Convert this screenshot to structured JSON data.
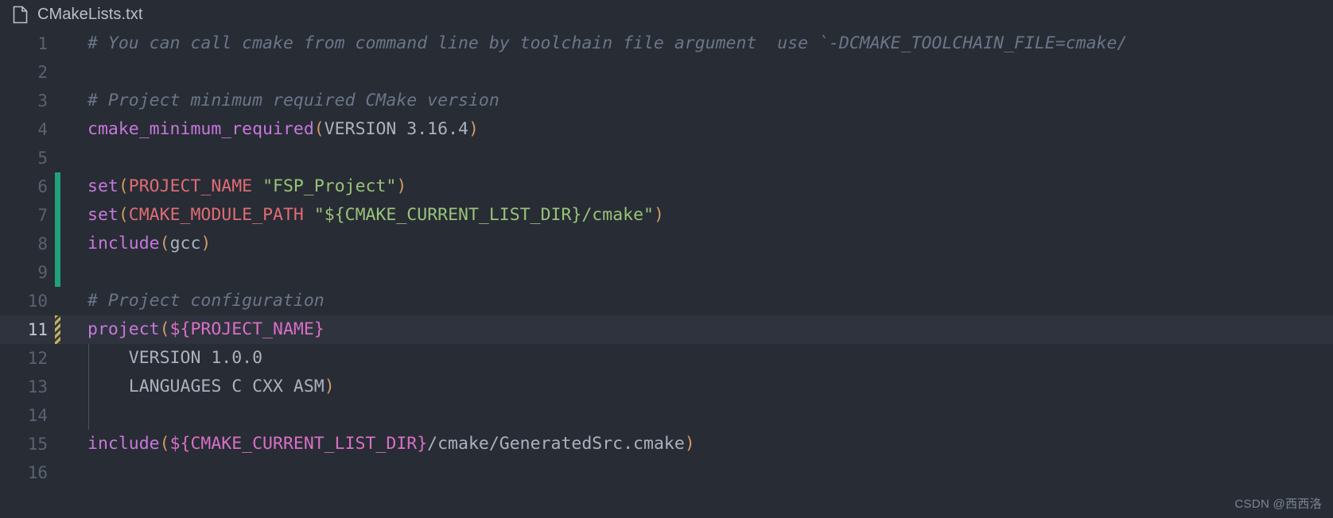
{
  "tab": {
    "filename": "CMakeLists.txt",
    "icon": "file-icon"
  },
  "watermark": "CSDN @西西洛",
  "colors": {
    "background": "#282c34",
    "active_line": "#2f333d",
    "gutter_text": "#5a6272",
    "gutter_active_text": "#c3cad6",
    "comment": "#6b7689",
    "function": "#c678dd",
    "paren": "#d19a66",
    "variable": "#e06c75",
    "string": "#98c379",
    "plain": "#abb2bf",
    "substitution": "#d96fc8",
    "git_added": "#21a179",
    "git_modified": "#b8a55a"
  },
  "editor": {
    "lines": [
      {
        "number": "1",
        "active": false,
        "marker": "none",
        "indent_guide": false,
        "tokens": [
          {
            "cls": "t-comment",
            "text": "# You can call cmake from command line by toolchain file argument  use `-DCMAKE_TOOLCHAIN_FILE=cmake/"
          }
        ]
      },
      {
        "number": "2",
        "active": false,
        "marker": "none",
        "indent_guide": false,
        "tokens": []
      },
      {
        "number": "3",
        "active": false,
        "marker": "none",
        "indent_guide": false,
        "tokens": [
          {
            "cls": "t-comment",
            "text": "# Project minimum required CMake version"
          }
        ]
      },
      {
        "number": "4",
        "active": false,
        "marker": "none",
        "indent_guide": false,
        "tokens": [
          {
            "cls": "t-func",
            "text": "cmake_minimum_required"
          },
          {
            "cls": "t-paren",
            "text": "("
          },
          {
            "cls": "t-plain",
            "text": "VERSION 3.16.4"
          },
          {
            "cls": "t-paren",
            "text": ")"
          }
        ]
      },
      {
        "number": "5",
        "active": false,
        "marker": "none",
        "indent_guide": false,
        "tokens": []
      },
      {
        "number": "6",
        "active": false,
        "marker": "added",
        "indent_guide": false,
        "tokens": [
          {
            "cls": "t-func",
            "text": "set"
          },
          {
            "cls": "t-paren",
            "text": "("
          },
          {
            "cls": "t-var",
            "text": "PROJECT_NAME"
          },
          {
            "cls": "t-plain",
            "text": " "
          },
          {
            "cls": "t-string",
            "text": "\"FSP_Project\""
          },
          {
            "cls": "t-paren",
            "text": ")"
          }
        ]
      },
      {
        "number": "7",
        "active": false,
        "marker": "added",
        "indent_guide": false,
        "tokens": [
          {
            "cls": "t-func",
            "text": "set"
          },
          {
            "cls": "t-paren",
            "text": "("
          },
          {
            "cls": "t-var",
            "text": "CMAKE_MODULE_PATH"
          },
          {
            "cls": "t-plain",
            "text": " "
          },
          {
            "cls": "t-string",
            "text": "\"${CMAKE_CURRENT_LIST_DIR}/cmake\""
          },
          {
            "cls": "t-paren",
            "text": ")"
          }
        ]
      },
      {
        "number": "8",
        "active": false,
        "marker": "added",
        "indent_guide": false,
        "tokens": [
          {
            "cls": "t-func",
            "text": "include"
          },
          {
            "cls": "t-paren",
            "text": "("
          },
          {
            "cls": "t-plain",
            "text": "gcc"
          },
          {
            "cls": "t-paren",
            "text": ")"
          }
        ]
      },
      {
        "number": "9",
        "active": false,
        "marker": "added",
        "indent_guide": false,
        "tokens": []
      },
      {
        "number": "10",
        "active": false,
        "marker": "none",
        "indent_guide": false,
        "tokens": [
          {
            "cls": "t-comment",
            "text": "# Project configuration"
          }
        ]
      },
      {
        "number": "11",
        "active": true,
        "marker": "modified",
        "indent_guide": false,
        "tokens": [
          {
            "cls": "t-func",
            "text": "project"
          },
          {
            "cls": "t-paren",
            "text": "("
          },
          {
            "cls": "t-subst",
            "text": "${PROJECT_NAME}"
          }
        ]
      },
      {
        "number": "12",
        "active": false,
        "marker": "none",
        "indent_guide": true,
        "tokens": [
          {
            "cls": "t-plain",
            "text": "    VERSION 1.0.0"
          }
        ]
      },
      {
        "number": "13",
        "active": false,
        "marker": "none",
        "indent_guide": true,
        "tokens": [
          {
            "cls": "t-plain",
            "text": "    LANGUAGES C CXX ASM"
          },
          {
            "cls": "t-paren",
            "text": ")"
          }
        ]
      },
      {
        "number": "14",
        "active": false,
        "marker": "none",
        "indent_guide": true,
        "tokens": []
      },
      {
        "number": "15",
        "active": false,
        "marker": "none",
        "indent_guide": false,
        "tokens": [
          {
            "cls": "t-func",
            "text": "include"
          },
          {
            "cls": "t-paren",
            "text": "("
          },
          {
            "cls": "t-subst",
            "text": "${CMAKE_CURRENT_LIST_DIR}"
          },
          {
            "cls": "t-path",
            "text": "/cmake/GeneratedSrc.cmake"
          },
          {
            "cls": "t-paren",
            "text": ")"
          }
        ]
      },
      {
        "number": "16",
        "active": false,
        "marker": "none",
        "indent_guide": false,
        "tokens": []
      }
    ]
  }
}
